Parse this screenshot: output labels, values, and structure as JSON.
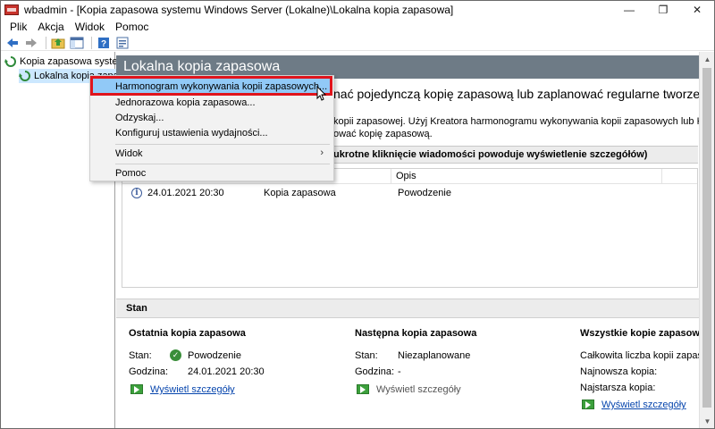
{
  "window": {
    "title": "wbadmin - [Kopia zapasowa systemu Windows Server (Lokalne)\\Lokalna kopia zapasowa]",
    "controls": {
      "minimize": "—",
      "maximize": "❐",
      "close": "✕"
    }
  },
  "menubar": {
    "items": [
      "Plik",
      "Akcja",
      "Widok",
      "Pomoc"
    ]
  },
  "tree": {
    "root_label": "Kopia zapasowa systemu Windows Server (Lokalne)",
    "child_label": "Lokalna kopia zapasowa"
  },
  "main": {
    "header": "Lokalna kopia zapasowa",
    "heading_partial": "nać pojedynczą kopię zapasową lub zaplanować regularne tworzenie kopii zapasowych.",
    "desc_partial": "kopii zapasowej. Użyj Kreatora harmonogramu wykonywania kopii zapasowych lub Kreatora jednorazowej kopii zapasowej, aby",
    "desc_partial2": "ować kopię zapasową.",
    "messages_bar": "ukrotne kliknięcie wiadomości powoduje wyświetlenie szczegółów)",
    "messages": {
      "columns": {
        "desc": "Opis"
      },
      "rows": [
        {
          "time": "24.01.2021 20:30",
          "type": "Kopia zapasowa",
          "desc": "Powodzenie"
        }
      ]
    },
    "stan": {
      "title": "Stan",
      "last": {
        "title": "Ostatnia kopia zapasowa",
        "stan_label": "Stan:",
        "stan_value": "Powodzenie",
        "time_label": "Godzina:",
        "time_value": "24.01.2021 20:30",
        "link": "Wyświetl szczegóły"
      },
      "next": {
        "title": "Następna kopia zapasowa",
        "stan_label": "Stan:",
        "stan_value": "Niezaplanowane",
        "time_label": "Godzina:",
        "time_value": "-",
        "link": "Wyświetl szczegóły"
      },
      "all": {
        "title": "Wszystkie kopie zapasowe",
        "total_label": "Całkowita liczba kopii zapasowych:",
        "newest_label": "Najnowsza kopia:",
        "oldest_label": "Najstarsza kopia:",
        "link": "Wyświetl szczegóły"
      }
    }
  },
  "context_menu": {
    "items": [
      "Harmonogram wykonywania kopii zapasowych...",
      "Jednorazowa kopia zapasowa...",
      "Odzyskaj...",
      "Konfiguruj ustawienia wydajności...",
      "Widok",
      "Pomoc"
    ],
    "submenu_arrow": "›"
  },
  "colors": {
    "header_bg": "#6e7b86",
    "highlight": "#91c9f7",
    "annotation_red": "#e0141c",
    "link": "#0645ad"
  }
}
